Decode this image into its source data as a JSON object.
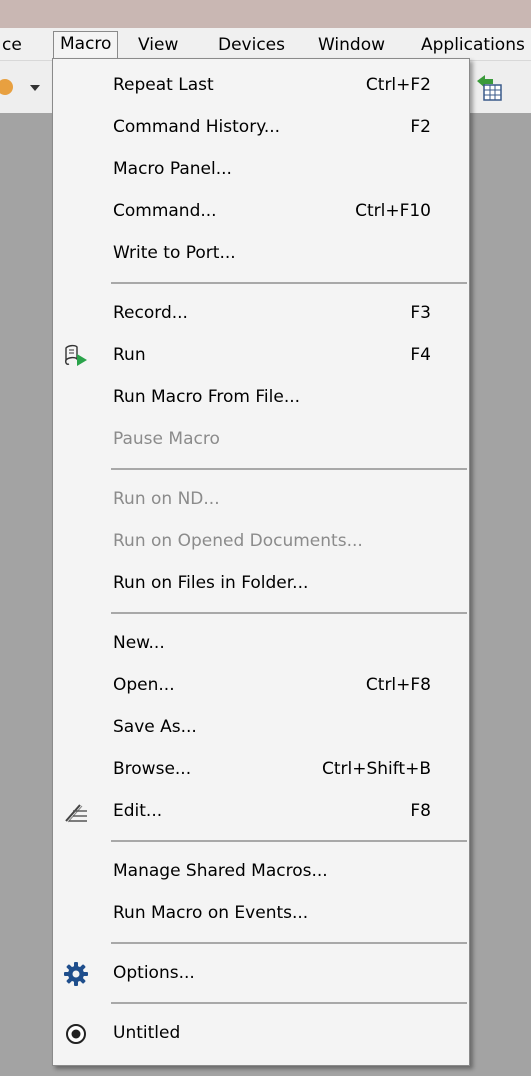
{
  "menubar": {
    "items": [
      {
        "label": "ce"
      },
      {
        "label": "Macro"
      },
      {
        "label": "View"
      },
      {
        "label": "Devices"
      },
      {
        "label": "Window"
      },
      {
        "label": "Applications"
      }
    ]
  },
  "menu": {
    "groups": [
      [
        {
          "label": "Repeat Last",
          "shortcut": "Ctrl+F2",
          "enabled": true
        },
        {
          "label": "Command History...",
          "shortcut": "F2",
          "enabled": true
        },
        {
          "label": "Macro Panel...",
          "shortcut": "",
          "enabled": true
        },
        {
          "label": "Command...",
          "shortcut": "Ctrl+F10",
          "enabled": true
        },
        {
          "label": "Write to Port...",
          "shortcut": "",
          "enabled": true
        }
      ],
      [
        {
          "label": "Record...",
          "shortcut": "F3",
          "enabled": true
        },
        {
          "label": "Run",
          "shortcut": "F4",
          "enabled": true,
          "icon": "run-macro-icon"
        },
        {
          "label": "Run Macro From File...",
          "shortcut": "",
          "enabled": true
        },
        {
          "label": "Pause Macro",
          "shortcut": "",
          "enabled": false
        }
      ],
      [
        {
          "label": "Run on ND...",
          "shortcut": "",
          "enabled": false
        },
        {
          "label": "Run on Opened Documents...",
          "shortcut": "",
          "enabled": false
        },
        {
          "label": "Run on Files in Folder...",
          "shortcut": "",
          "enabled": true
        }
      ],
      [
        {
          "label": "New...",
          "shortcut": "",
          "enabled": true
        },
        {
          "label": "Open...",
          "shortcut": "Ctrl+F8",
          "enabled": true
        },
        {
          "label": "Save As...",
          "shortcut": "",
          "enabled": true
        },
        {
          "label": "Browse...",
          "shortcut": "Ctrl+Shift+B",
          "enabled": true
        },
        {
          "label": "Edit...",
          "shortcut": "F8",
          "enabled": true,
          "icon": "edit-macro-icon"
        }
      ],
      [
        {
          "label": "Manage Shared Macros...",
          "shortcut": "",
          "enabled": true
        },
        {
          "label": "Run Macro on Events...",
          "shortcut": "",
          "enabled": true
        }
      ],
      [
        {
          "label": "Options...",
          "shortcut": "",
          "enabled": true,
          "icon": "gear-icon"
        }
      ],
      [
        {
          "label": "Untitled",
          "shortcut": "",
          "enabled": true,
          "icon": "radio-selected-icon"
        }
      ]
    ]
  },
  "colors": {
    "menu_bg": "#f4f4f4",
    "disabled_text": "#8b8b8b",
    "separator": "#a8a8a8",
    "icon_blue": "#1f4e8c"
  }
}
